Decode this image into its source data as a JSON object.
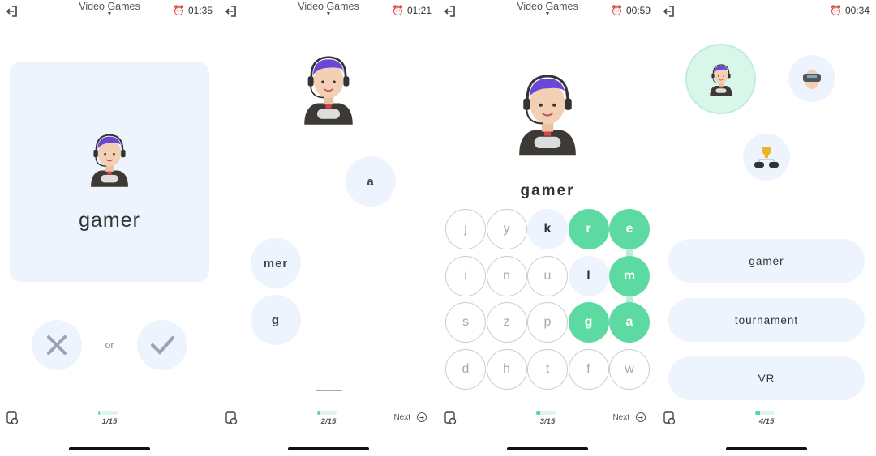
{
  "header": {
    "title": "Video Games"
  },
  "colors": {
    "accent": "#5ddaa1",
    "card": "#eef4fd"
  },
  "screens": [
    {
      "timer": "01:35",
      "word": "gamer",
      "or_label": "or",
      "progress": "1/15",
      "progress_fraction": 0.0667
    },
    {
      "timer": "01:21",
      "bubbles": [
        "a",
        "mer",
        "g"
      ],
      "answer_blanks": "_____",
      "progress": "2/15",
      "progress_fraction": 0.1333,
      "next_label": "Next"
    },
    {
      "timer": "00:59",
      "word": "gamer",
      "grid": [
        [
          "j",
          "y",
          "k",
          "r",
          "e"
        ],
        [
          "i",
          "n",
          "u",
          "l",
          "m"
        ],
        [
          "s",
          "z",
          "p",
          "g",
          "a"
        ],
        [
          "d",
          "h",
          "t",
          "f",
          "w"
        ]
      ],
      "selected": [
        "r",
        "e",
        "m",
        "g",
        "a"
      ],
      "hints": [
        "k",
        "l"
      ],
      "progress": "3/15",
      "progress_fraction": 0.2,
      "next_label": "Next"
    },
    {
      "timer": "00:34",
      "options": [
        "gamer",
        "tournament",
        "VR"
      ],
      "images": [
        "gamer-avatar",
        "vr-headset-person",
        "tournament-trophy"
      ],
      "progress": "4/15",
      "progress_fraction": 0.2667
    }
  ]
}
